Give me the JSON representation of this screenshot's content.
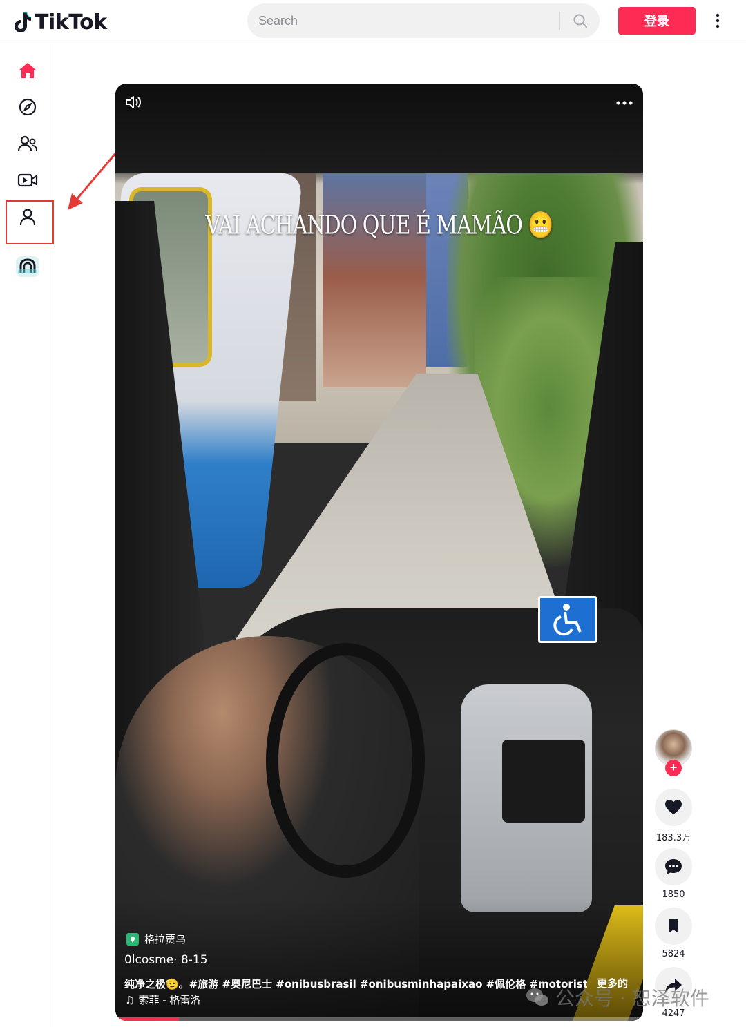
{
  "header": {
    "logo_text": "TikTok",
    "search_placeholder": "Search",
    "login_label": "登录"
  },
  "sidebar": {
    "items": [
      {
        "name": "home-icon",
        "active": true
      },
      {
        "name": "explore-icon",
        "active": false
      },
      {
        "name": "following-icon",
        "active": false
      },
      {
        "name": "live-icon",
        "active": false
      },
      {
        "name": "profile-icon",
        "active": false,
        "highlighted": true
      },
      {
        "name": "more-app-icon",
        "active": false
      }
    ]
  },
  "colors": {
    "brand": "#fe2c55",
    "highlight": "#e53935"
  },
  "video": {
    "caption": "VAI ACHANDO QUE É MAMÃO 😬",
    "location": "格拉贾乌",
    "author_line": "0lcosme· 8-15",
    "description": "纯净之极🫡。#旅游  #奥尼巴士  #onibusbrasil  #onibusminhapaixao  #佩伦格  #motorista  ...",
    "more_label": "更多的",
    "music_label": "索菲 - 格雷洛",
    "progress": 0.12
  },
  "actions": {
    "likes": "183.3万",
    "comments": "1850",
    "saves": "5824",
    "shares": "4247"
  },
  "watermark": {
    "text": "公众号 · 恕泽软件"
  }
}
